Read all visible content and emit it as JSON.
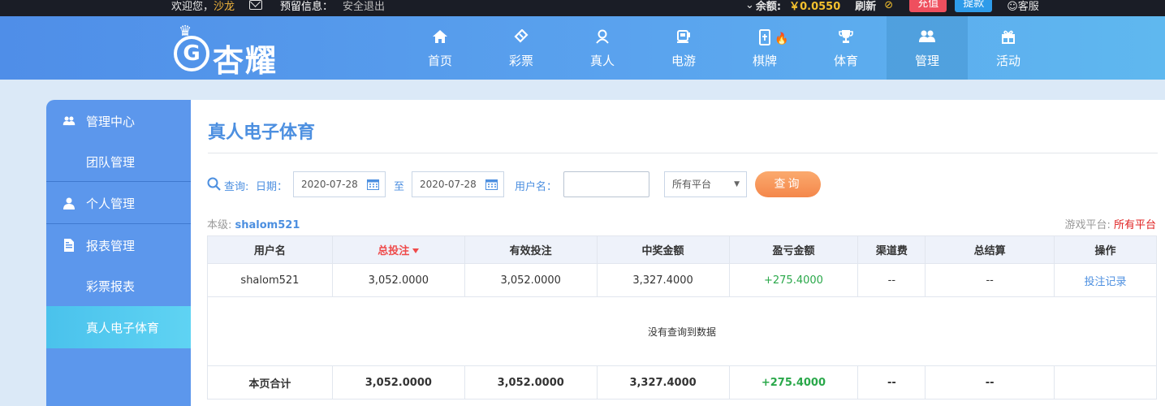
{
  "topbar": {
    "welcome": "欢迎您，",
    "username": "沙龙",
    "message_label": "预留信息：",
    "logout": "安全退出",
    "balance_label": "余额:",
    "balance_value": "￥0.0550",
    "refresh": "刷新",
    "recharge": "充值",
    "withdraw": "提款",
    "service": "客服"
  },
  "logo": {
    "text": "杏耀"
  },
  "nav": [
    {
      "label": "首页",
      "icon": "home-icon"
    },
    {
      "label": "彩票",
      "icon": "ticket-icon"
    },
    {
      "label": "真人",
      "icon": "person-icon"
    },
    {
      "label": "电游",
      "icon": "slot-icon"
    },
    {
      "label": "棋牌",
      "icon": "cards-icon"
    },
    {
      "label": "体育",
      "icon": "trophy-icon"
    },
    {
      "label": "管理",
      "icon": "users-icon"
    },
    {
      "label": "活动",
      "icon": "gift-icon"
    }
  ],
  "sidebar": {
    "items": [
      {
        "label": "管理中心",
        "icon": "users-icon"
      },
      {
        "label": "团队管理"
      },
      {
        "label": "个人管理",
        "icon": "user-icon"
      },
      {
        "label": "报表管理",
        "icon": "report-icon"
      },
      {
        "label": "彩票报表"
      },
      {
        "label": "真人电子体育"
      }
    ]
  },
  "page": {
    "title": "真人电子体育"
  },
  "query": {
    "label": "查询:",
    "date_label": "日期：",
    "date_from": "2020-07-28",
    "to": "至",
    "date_to": "2020-07-28",
    "username_label": "用户名：",
    "username_value": "",
    "platform_selected": "所有平台",
    "button": "查询"
  },
  "info": {
    "level_label": "本级:",
    "level_value": "shalom521",
    "platform_label": "游戏平台:",
    "platform_value": "所有平台"
  },
  "table": {
    "headers": [
      "用户名",
      "总投注",
      "有效投注",
      "中奖金额",
      "盈亏金额",
      "渠道费",
      "总结算",
      "操作"
    ],
    "row": [
      "shalom521",
      "3,052.0000",
      "3,052.0000",
      "3,327.4000",
      "+275.4000",
      "--",
      "--",
      "投注记录"
    ],
    "empty_text": "没有查询到数据",
    "total": [
      "本页合计",
      "3,052.0000",
      "3,052.0000",
      "3,327.4000",
      "+275.4000",
      "--",
      "--",
      ""
    ]
  },
  "colors": {
    "nav_blue": "#5aa3ee",
    "sidebar_blue": "#5c97ec",
    "title_blue": "#4c8fe0",
    "positive_green": "#2aa84a",
    "accent_orange": "#f4874b",
    "sort_red": "#ef4b4b"
  }
}
